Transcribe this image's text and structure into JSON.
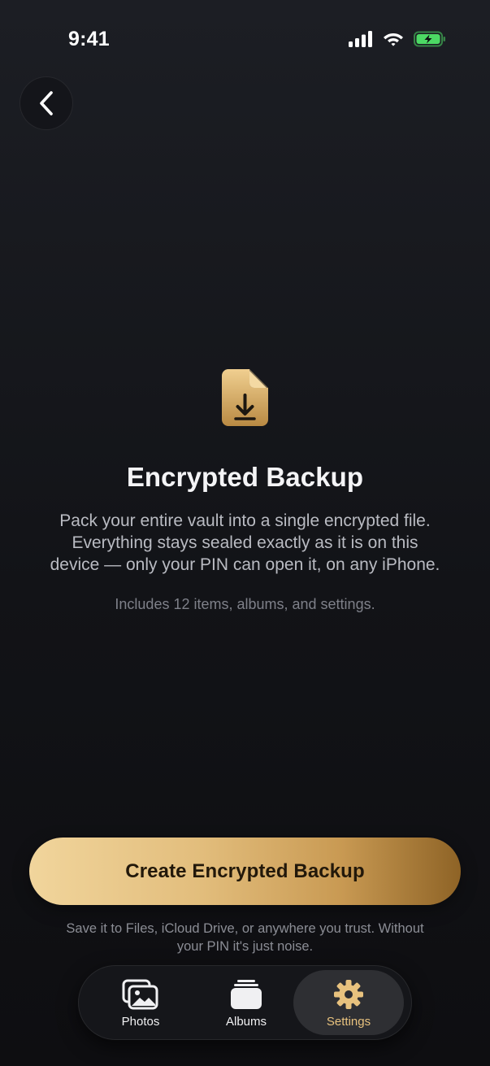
{
  "status_bar": {
    "time": "9:41",
    "icons": [
      "signal-icon",
      "wifi-icon",
      "battery-charging-icon"
    ],
    "battery_color": "#4cd964"
  },
  "nav": {
    "back_icon": "chevron-left-icon"
  },
  "hero": {
    "icon": "document-download-icon",
    "title": "Encrypted Backup",
    "description_line1": "Pack your entire vault into a single encrypted file.",
    "description_line2": "Everything stays sealed exactly as it is on this",
    "description_line3": "device — only your PIN can open it, on any iPhone.",
    "items_note": "Includes 12 items, albums, and settings."
  },
  "cta": {
    "label": "Create Encrypted Backup",
    "footnote_line1": "Save it to Files, iCloud Drive, or anywhere you trust. Without",
    "footnote_line2": "your PIN it's just noise."
  },
  "tab_bar": {
    "tabs": [
      {
        "label": "Photos",
        "icon": "photos-icon",
        "selected": false
      },
      {
        "label": "Albums",
        "icon": "albums-icon",
        "selected": false
      },
      {
        "label": "Settings",
        "icon": "gear-icon",
        "selected": true
      }
    ]
  },
  "colors": {
    "accent_gold": "#e2bd7c",
    "background": "#121317"
  }
}
